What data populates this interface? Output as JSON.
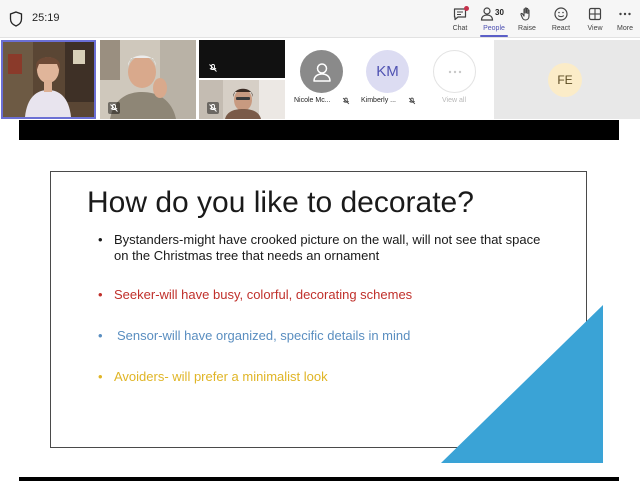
{
  "meeting": {
    "timer": "25:19"
  },
  "toolbar": {
    "chat_label": "Chat",
    "people_label": "People",
    "people_count": "30",
    "raise_label": "Raise",
    "react_label": "React",
    "view_label": "View",
    "more_label": "More"
  },
  "participants": {
    "nicole_name": "Nicole Mc...",
    "kimberly_name": "Kimberly ...",
    "kimberly_initials": "KM",
    "view_all_label": "View all",
    "fe_initials": "FE"
  },
  "slide": {
    "title": "How do you like to decorate?",
    "bullets": [
      {
        "text": "Bystanders-might have crooked picture on the wall, will not see that space on the Christmas tree that needs an ornament",
        "color": "#1a1a1a"
      },
      {
        "text": "Seeker-will have busy, colorful, decorating schemes",
        "color": "#c0302b"
      },
      {
        "text": "Sensor-will have organized, specific details in mind",
        "color": "#5a8ec0"
      },
      {
        "text": "Avoiders- will prefer a minimalist look",
        "color": "#e0b526"
      }
    ],
    "accent_color": "#3aa3d6"
  }
}
